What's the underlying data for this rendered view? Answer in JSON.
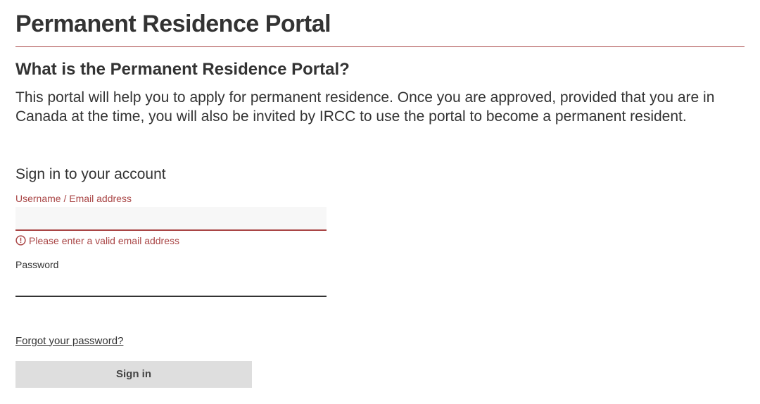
{
  "page_title": "Permanent Residence Portal",
  "subheading": "What is the Permanent Residence Portal?",
  "intro_text": "This portal will help you to apply for permanent residence. Once you are approved, provided that you are in Canada at the time, you will also be invited by IRCC to use the portal to become a permanent resident.",
  "signin": {
    "heading": "Sign in to your account",
    "username_label": "Username / Email address",
    "username_value": "",
    "username_error": "Please enter a valid email address",
    "password_label": "Password",
    "password_value": "",
    "forgot_link": "Forgot your password?",
    "signin_button": "Sign in"
  },
  "colors": {
    "accent": "#a94545",
    "text": "#333",
    "button_bg": "#dedede"
  }
}
